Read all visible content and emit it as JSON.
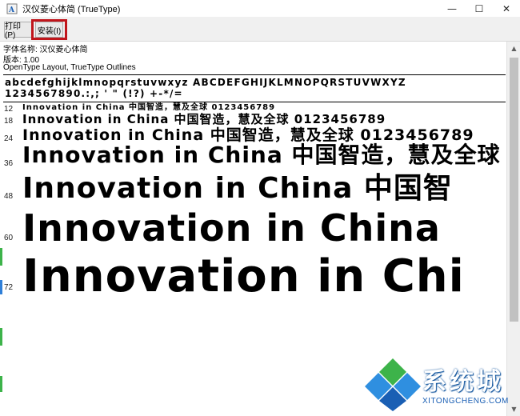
{
  "window": {
    "title": "汉仪菱心体简 (TrueType)",
    "controls": {
      "minimize": "—",
      "maximize": "☐",
      "close": "✕"
    }
  },
  "toolbar": {
    "print_label": "打印(P)",
    "install_label": "安装(I)"
  },
  "font_info": {
    "name_line": "字体名称: 汉仪菱心体简",
    "version_line": "版本: 1.00",
    "type_line": "OpenType Layout, TrueType Outlines"
  },
  "charset": {
    "line1": "abcdefghijklmnopqrstuvwxyz ABCDEFGHIJKLMNOPQRSTUVWXYZ",
    "line2": "1234567890.:,; ' \" (!?) +-*/="
  },
  "samples": [
    {
      "size": "12",
      "text": "Innovation in China 中国智造，慧及全球 0123456789"
    },
    {
      "size": "18",
      "text": "Innovation in China 中国智造，慧及全球 0123456789"
    },
    {
      "size": "24",
      "text": "Innovation in China 中国智造，慧及全球 0123456789"
    },
    {
      "size": "36",
      "text": "Innovation in China 中国智造，慧及全球"
    },
    {
      "size": "48",
      "text": "Innovation in China 中国智"
    },
    {
      "size": "60",
      "text": "Innovation in China"
    },
    {
      "size": "72",
      "text": "Innovation in Chi"
    }
  ],
  "watermark": {
    "text": "系统城",
    "url": "XITONGCHENG.COM"
  },
  "colors": {
    "highlight": "#c0151b",
    "toolbar_bg": "#f0f0f0",
    "watermark_blue": "#1a5fb4",
    "watermark_green": "#3db34a"
  }
}
